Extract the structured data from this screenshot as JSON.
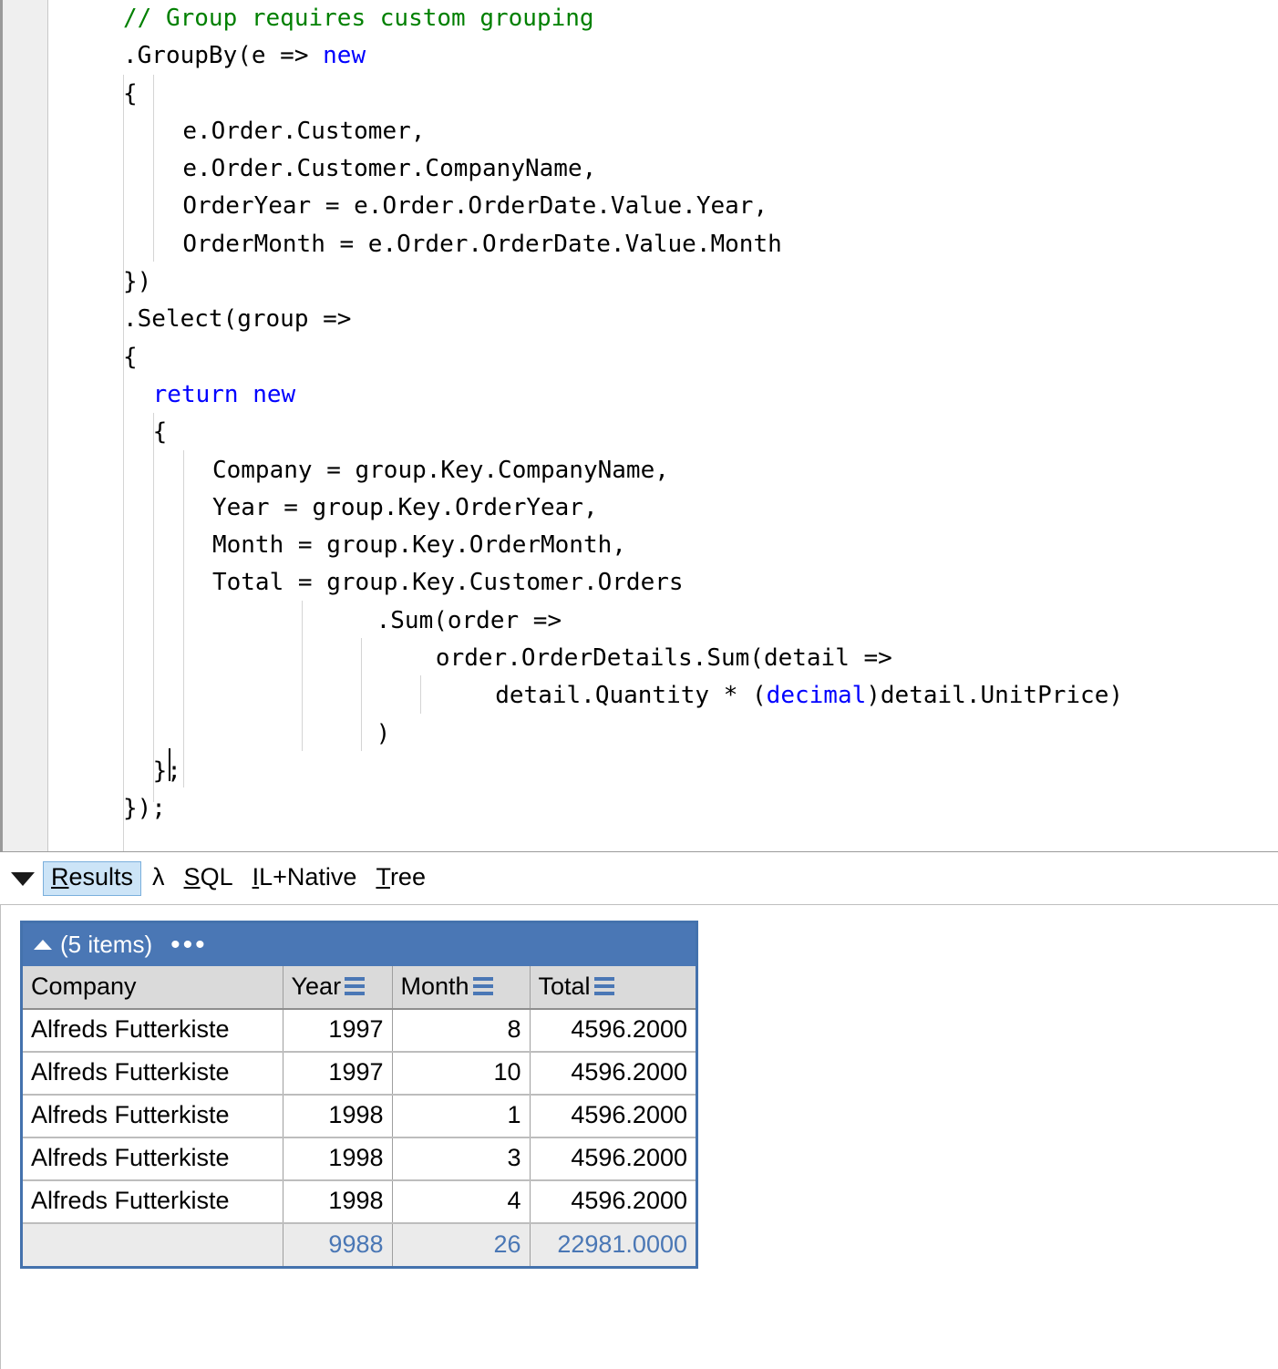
{
  "editor": {
    "language": "csharp",
    "code_lines": [
      {
        "indent": 0,
        "tokens": [
          {
            "t": "// Group requires custom grouping",
            "c": "cmt"
          }
        ]
      },
      {
        "indent": 0,
        "tokens": [
          {
            "t": ".GroupBy(e => ",
            "c": ""
          },
          {
            "t": "new",
            "c": "kw"
          }
        ]
      },
      {
        "indent": 0,
        "tokens": [
          {
            "t": "{",
            "c": ""
          }
        ]
      },
      {
        "indent": 4,
        "tokens": [
          {
            "t": "e.Order.Customer,",
            "c": ""
          }
        ]
      },
      {
        "indent": 4,
        "tokens": [
          {
            "t": "e.Order.Customer.CompanyName,",
            "c": ""
          }
        ]
      },
      {
        "indent": 4,
        "tokens": [
          {
            "t": "OrderYear = e.Order.OrderDate.Value.Year,",
            "c": ""
          }
        ]
      },
      {
        "indent": 4,
        "tokens": [
          {
            "t": "OrderMonth = e.Order.OrderDate.Value.Month",
            "c": ""
          }
        ]
      },
      {
        "indent": 0,
        "tokens": [
          {
            "t": "})",
            "c": ""
          }
        ]
      },
      {
        "indent": 0,
        "tokens": [
          {
            "t": ".Select(group =>",
            "c": ""
          }
        ]
      },
      {
        "indent": 0,
        "tokens": [
          {
            "t": "{",
            "c": ""
          }
        ]
      },
      {
        "indent": 2,
        "tokens": [
          {
            "t": "return new",
            "c": "kw"
          }
        ]
      },
      {
        "indent": 2,
        "tokens": [
          {
            "t": "{",
            "c": ""
          }
        ]
      },
      {
        "indent": 6,
        "tokens": [
          {
            "t": "Company = group.Key.CompanyName,",
            "c": ""
          }
        ]
      },
      {
        "indent": 6,
        "tokens": [
          {
            "t": "Year = group.Key.OrderYear,",
            "c": ""
          }
        ]
      },
      {
        "indent": 6,
        "tokens": [
          {
            "t": "Month = group.Key.OrderMonth,",
            "c": ""
          }
        ]
      },
      {
        "indent": 6,
        "tokens": [
          {
            "t": "Total = group.Key.Customer.Orders",
            "c": ""
          }
        ]
      },
      {
        "indent": 17,
        "tokens": [
          {
            "t": ".Sum(order =>",
            "c": ""
          }
        ]
      },
      {
        "indent": 21,
        "tokens": [
          {
            "t": "order.OrderDetails.Sum(detail =>",
            "c": ""
          }
        ]
      },
      {
        "indent": 25,
        "tokens": [
          {
            "t": "detail.Quantity * (",
            "c": ""
          },
          {
            "t": "decimal",
            "c": "kw"
          },
          {
            "t": ")detail.UnitPrice)",
            "c": ""
          }
        ]
      },
      {
        "indent": 17,
        "tokens": [
          {
            "t": ")",
            "c": ""
          }
        ]
      },
      {
        "indent": 2,
        "tokens": [
          {
            "t": "};",
            "c": ""
          }
        ]
      },
      {
        "indent": 0,
        "tokens": [
          {
            "t": "});",
            "c": ""
          }
        ]
      }
    ],
    "plain_text": "// Group requires custom grouping\n.GroupBy(e => new\n{\n    e.Order.Customer,\n    e.Order.Customer.CompanyName,\n    OrderYear = e.Order.OrderDate.Value.Year,\n    OrderMonth = e.Order.OrderDate.Value.Month\n})\n.Select(group =>\n{\n  return new\n  {\n      Company = group.Key.CompanyName,\n      Year = group.Key.OrderYear,\n      Month = group.Key.OrderMonth,\n      Total = group.Key.Customer.Orders\n                 .Sum(order =>\n                     order.OrderDetails.Sum(detail =>\n                         detail.Quantity * (decimal)detail.UnitPrice)\n                 )\n  };\n});",
    "colors": {
      "comment": "#008000",
      "keyword": "#0000ff",
      "text": "#000000",
      "background": "#ffffff",
      "gutter": "#efefef"
    }
  },
  "tabbar": {
    "collapse_icon": "triangle-down-icon",
    "tabs": [
      {
        "label": "Results",
        "accel": "R",
        "selected": true
      },
      {
        "label": "λ",
        "accel": "",
        "selected": false
      },
      {
        "label": "SQL",
        "accel": "S",
        "selected": false
      },
      {
        "label": "IL+Native",
        "accel": "I",
        "selected": false
      },
      {
        "label": "Tree",
        "accel": "T",
        "selected": false
      }
    ],
    "selected_bg": "#cce4f7"
  },
  "results": {
    "title_bar": {
      "collapse_icon": "triangle-up-icon",
      "count_label": "(5 items)",
      "menu_icon": "ellipsis-icon",
      "background": "#4a77b5"
    },
    "columns": [
      {
        "key": "company",
        "label": "Company",
        "sortable": false,
        "align": "left"
      },
      {
        "key": "year",
        "label": "Year",
        "sortable": true,
        "align": "right"
      },
      {
        "key": "month",
        "label": "Month",
        "sortable": true,
        "align": "right"
      },
      {
        "key": "total",
        "label": "Total",
        "sortable": true,
        "align": "right"
      }
    ],
    "rows": [
      {
        "company": "Alfreds Futterkiste",
        "year": "1997",
        "month": "8",
        "total": "4596.2000"
      },
      {
        "company": "Alfreds Futterkiste",
        "year": "1997",
        "month": "10",
        "total": "4596.2000"
      },
      {
        "company": "Alfreds Futterkiste",
        "year": "1998",
        "month": "1",
        "total": "4596.2000"
      },
      {
        "company": "Alfreds Futterkiste",
        "year": "1998",
        "month": "3",
        "total": "4596.2000"
      },
      {
        "company": "Alfreds Futterkiste",
        "year": "1998",
        "month": "4",
        "total": "4596.2000"
      }
    ],
    "totals": {
      "company": "",
      "year": "9988",
      "month": "26",
      "total": "22981.0000"
    },
    "accent_color": "#4472ad",
    "totals_text_color": "#4a77b5"
  }
}
